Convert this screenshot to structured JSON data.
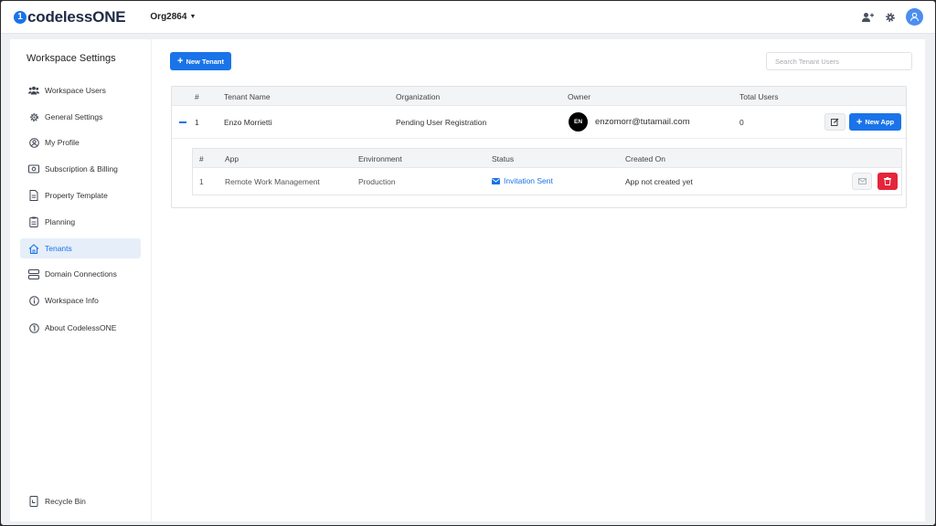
{
  "app": {
    "logo_mark": "1",
    "logo_text": "codelessONE",
    "org": "Org2864"
  },
  "topbar_icons": [
    "add-user-icon",
    "gear-icon",
    "user-avatar-icon"
  ],
  "sidebar": {
    "title": "Workspace Settings",
    "items": [
      {
        "label": "Workspace Users",
        "icon": "users-icon"
      },
      {
        "label": "General Settings",
        "icon": "gear-icon"
      },
      {
        "label": "My Profile",
        "icon": "profile-icon"
      },
      {
        "label": "Subscription & Billing",
        "icon": "billing-icon"
      },
      {
        "label": "Property Template",
        "icon": "document-icon"
      },
      {
        "label": "Planning",
        "icon": "clipboard-icon"
      },
      {
        "label": "Tenants",
        "icon": "home-icon",
        "active": true
      },
      {
        "label": "Domain Connections",
        "icon": "server-icon"
      },
      {
        "label": "Workspace Info",
        "icon": "info-icon"
      },
      {
        "label": "About CodelessONE",
        "icon": "about-icon"
      }
    ],
    "recycle_bin": "Recycle Bin"
  },
  "main": {
    "new_tenant_label": "New Tenant",
    "search_placeholder": "Search Tenant Users",
    "tenants_table": {
      "headers": [
        "#",
        "Tenant Name",
        "Organization",
        "Owner",
        "Total Users"
      ],
      "rows": [
        {
          "index": "1",
          "name": "Enzo Morrietti",
          "organization": "Pending User Registration",
          "owner_initials": "EN",
          "owner_email": "enzomorr@tutamail.com",
          "total_users": "0",
          "new_app_label": "New App"
        }
      ]
    },
    "apps_table": {
      "headers": [
        "#",
        "App",
        "Environment",
        "Status",
        "Created On"
      ],
      "rows": [
        {
          "index": "1",
          "app": "Remote Work Management",
          "environment": "Production",
          "status": "Invitation Sent",
          "created_on": "App not created yet"
        }
      ]
    }
  },
  "colors": {
    "accent": "#1a73e8",
    "danger": "#e5253a",
    "active_bg": "#e6eef9"
  }
}
